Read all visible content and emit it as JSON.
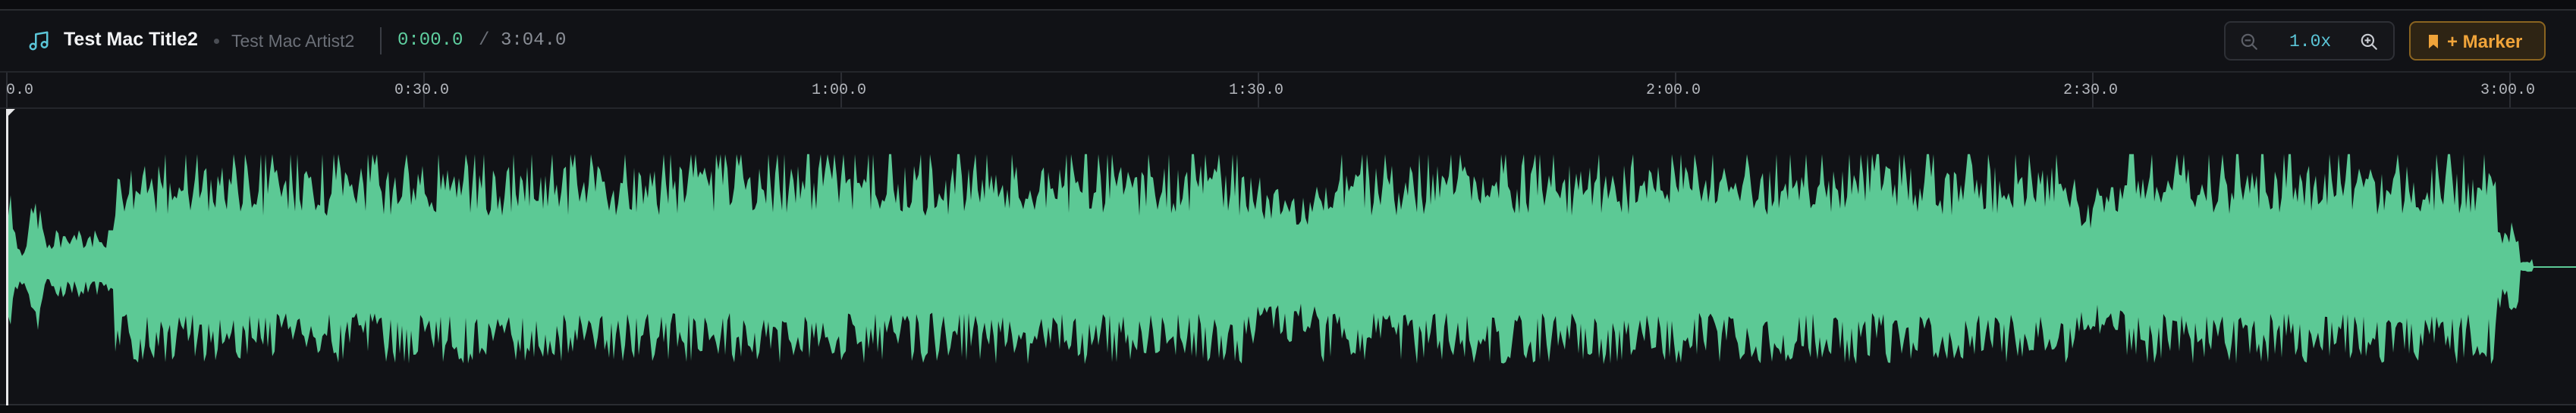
{
  "track": {
    "title": "Test Mac Title2",
    "artist": "Test Mac Artist2",
    "current_time": "0:00.0",
    "separator": "/",
    "total_time": "3:04.0"
  },
  "zoom": {
    "level": "1.0x"
  },
  "marker_button": {
    "label": "+ Marker"
  },
  "timeline": {
    "ticks": [
      "0.0",
      "0:30.0",
      "1:00.0",
      "1:30.0",
      "2:00.0",
      "2:30.0",
      "3:00.0"
    ]
  },
  "colors": {
    "waveform": "#5cc995",
    "accent_time": "#5fd0a0",
    "zoom_text": "#5bc6d8",
    "marker": "#f0a43a",
    "background": "#111216"
  },
  "icons": {
    "track": "music-note-icon",
    "zoom_out": "zoom-out-icon",
    "zoom_in": "zoom-in-icon",
    "marker": "bookmark-icon"
  }
}
